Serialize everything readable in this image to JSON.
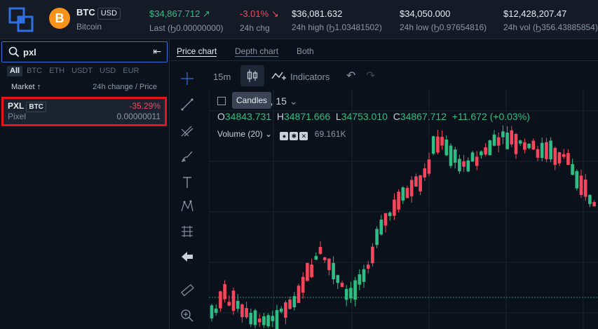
{
  "header": {
    "symbol": "BTC",
    "quote": "USD",
    "name": "Bitcoin",
    "coin_glyph": "B",
    "last_value": "$34,867.712",
    "last_label": "Last (Ϧ0.00000000)",
    "chg_value": "-3.01%",
    "chg_label": "24h chg",
    "high_value": "$36,081.632",
    "high_label": "24h high (Ϧ1.03481502)",
    "low_value": "$34,050.000",
    "low_label": "24h low (Ϧ0.97654816)",
    "vol_value": "$12,428,207.47",
    "vol_label": "24h vol (Ϧ356.43885854)"
  },
  "search": {
    "query": "pxl",
    "clear_glyph": "⇤"
  },
  "filters": [
    "All",
    "BTC",
    "ETH",
    "USDT",
    "USD",
    "EUR"
  ],
  "list_header": {
    "market": "Market ↑",
    "change_price": "24h change / Price"
  },
  "market_row": {
    "symbol": "PXL",
    "quote": "BTC",
    "name": "Pixel",
    "change": "-35.29%",
    "price": "0.00000011"
  },
  "tabs": [
    "Price chart",
    "Depth chart",
    "Both"
  ],
  "toolbar": {
    "interval": "15m",
    "indicators": "Indicators",
    "tooltip": "Candles"
  },
  "chart": {
    "symbol_partial": "C, 15",
    "ohlc_o": "34843.731",
    "ohlc_h": "34871.666",
    "ohlc_l": "34753.010",
    "ohlc_c": "34867.712",
    "ohlc_change": "+11.672 (+0.03%)",
    "volume_label": "Volume (20)",
    "volume_value": "69.161K"
  },
  "colors": {
    "up": "#2ebd85",
    "down": "#f6465d",
    "accent": "#3a6fd8"
  }
}
